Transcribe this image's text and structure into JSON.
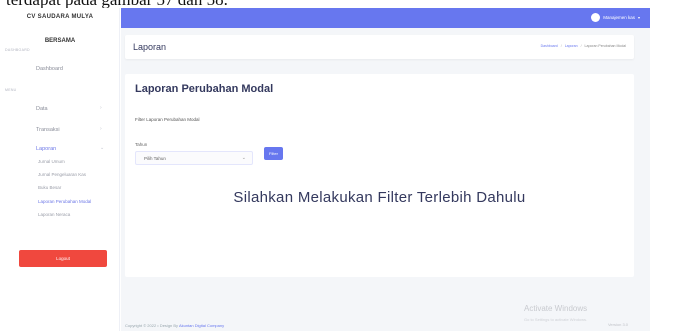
{
  "doc_snippet": "terdapat pada gambar 57 dan 58.",
  "sidebar": {
    "brand": "CV SAUDARA MULYA",
    "brand_sub": "BERSAMA",
    "section_dashboard": "DASHBOARD",
    "dashboard": "Dashboard",
    "section_menu": "MENU",
    "data": "Data",
    "transaksi": "Transaksi",
    "laporan": "Laporan",
    "sub_items": [
      "Jurnal Umum",
      "Jurnal Pengeluaran Kas",
      "Buku Besar",
      "Laporan Perubahan Modal",
      "Laporan Neraca"
    ],
    "logout": "Logout"
  },
  "topbar": {
    "user": "Manajemen kas",
    "accent": "#6777ef"
  },
  "header": {
    "title": "Laporan",
    "breadcrumb": [
      "Dashboard",
      "Laporan",
      "Laporan Perubahan Modal"
    ]
  },
  "card": {
    "title": "Laporan Perubahan Modal",
    "filter_label": "Filter Laporan Perubahan Modal",
    "tahun_label": "Tahun",
    "select_value": "Pilih Tahun",
    "filter_button": "Filter",
    "empty_message": "Silahkan Melakukan Filter Terlebih Dahulu"
  },
  "footer": {
    "copyright": "Copyright © 2022 •  Design By",
    "link": "Akuntan Digital Company",
    "version": "Version 3.0"
  },
  "watermark": {
    "title": "Activate Windows",
    "sub": "Go to Settings to activate Windows."
  }
}
